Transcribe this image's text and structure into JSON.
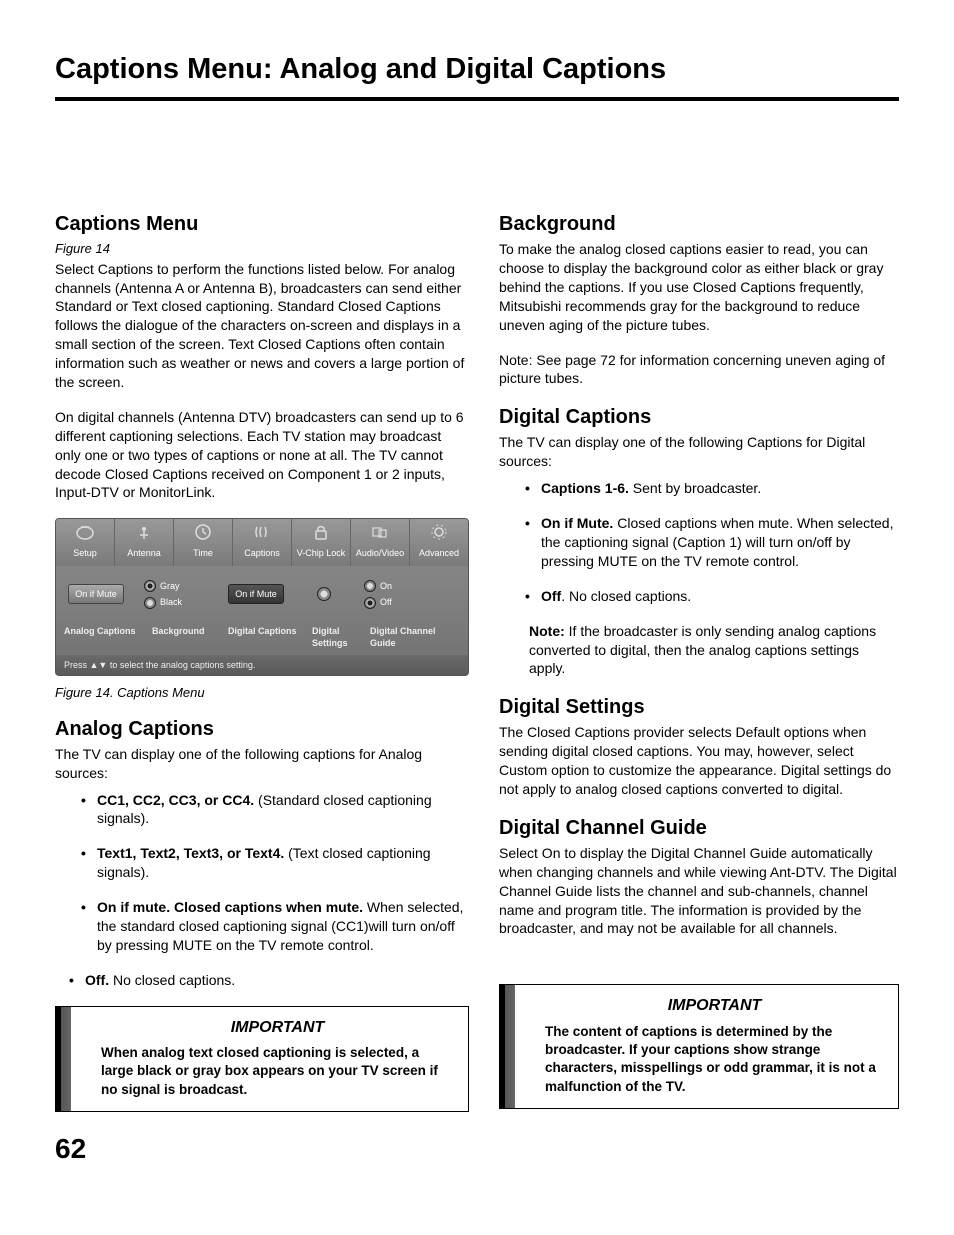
{
  "page": {
    "title": "Captions Menu: Analog and Digital Captions",
    "number": "62"
  },
  "left": {
    "captions_menu": {
      "heading": "Captions Menu",
      "figure_ref": "Figure 14",
      "para1": "Select Captions to perform the functions listed below.  For analog channels (Antenna A or Antenna B), broadcasters can send either Standard or Text closed captioning.  Standard Closed Captions follows the dialogue of the characters on-screen and displays in a small section of the screen.  Text Closed Captions often contain information such as weather or news and covers a large portion of the screen.",
      "para2": "On digital channels (Antenna DTV) broadcasters can send up to 6 different captioning selections.   Each TV station may broadcast only one or two types of captions or none at all.  The TV cannot decode Closed Captions received on Component 1 or 2 inputs, Input-DTV or MonitorLink."
    },
    "figure": {
      "tabs": [
        "Setup",
        "Antenna",
        "Time",
        "Captions",
        "V-Chip Lock",
        "Audio/Video",
        "Advanced"
      ],
      "analog_btn": "On if Mute",
      "bg_gray": "Gray",
      "bg_black": "Black",
      "digital_btn": "On if Mute",
      "on": "On",
      "off": "Off",
      "labels": [
        "Analog Captions",
        "Background",
        "Digital Captions",
        "Digital Settings",
        "Digital Channel Guide"
      ],
      "footer": "Press ▲▼ to select the analog captions setting.",
      "caption": "Figure 14. Captions Menu"
    },
    "analog": {
      "heading": "Analog Captions",
      "intro": "The TV can display one of the following captions for Analog sources:",
      "bullets": [
        {
          "b": "CC1, CC2, CC3, or CC4.",
          "t": " (Standard closed captioning signals)."
        },
        {
          "b": "Text1, Text2, Text3, or Text4.",
          "t": " (Text closed captioning signals)."
        },
        {
          "b": "On if mute.  Closed captions when mute.",
          "t": "  When selected, the standard closed captioning signal (CC1)will turn on/off by pressing MUTE on the TV remote control."
        },
        {
          "b": "Off.",
          "t": " No closed captions."
        }
      ]
    },
    "important": {
      "title": "IMPORTANT",
      "text": "When analog text closed captioning is selected, a large black or gray box appears on your TV screen if no signal is broadcast."
    }
  },
  "right": {
    "background": {
      "heading": "Background",
      "para": "To make the analog closed captions easier to read, you can choose to display the background color as either black or gray behind the captions.  If you use Closed Captions frequently, Mitsubishi recommends gray for the background to reduce uneven aging of the picture tubes.",
      "note": "Note:  See page 72 for information concerning uneven aging of picture tubes."
    },
    "digital_captions": {
      "heading": "Digital Captions",
      "intro": "The TV can display one of the following Captions for Digital sources:",
      "bullets": [
        {
          "b": "Captions 1-6.",
          "t": "  Sent by broadcaster."
        },
        {
          "b": "On if Mute.",
          "t": "  Closed captions when mute.  When selected, the captioning signal (Caption 1) will turn on/off by pressing MUTE on the TV remote control."
        },
        {
          "b": "Off",
          "t": ". No closed captions."
        }
      ],
      "note_b": "Note:",
      "note_t": "  If the broadcaster is only sending analog captions converted to digital, then the analog captions settings apply."
    },
    "digital_settings": {
      "heading": "Digital Settings",
      "para": "The Closed Captions provider selects Default options when sending digital closed captions.  You may, however, select Custom option to customize the appearance.  Digital settings do not apply to analog closed captions converted to digital."
    },
    "channel_guide": {
      "heading": "Digital Channel Guide",
      "para": "Select On to display the Digital Channel Guide automatically when changing channels and while viewing Ant-DTV.  The Digital Channel Guide lists the channel and sub-channels, channel name and program title.  The information is provided by the broadcaster, and may not be available for all channels."
    },
    "important": {
      "title": "IMPORTANT",
      "text": "The content of captions is determined by the broadcaster.  If your captions show strange characters, misspellings or odd grammar, it is not a malfunction of the TV."
    }
  }
}
